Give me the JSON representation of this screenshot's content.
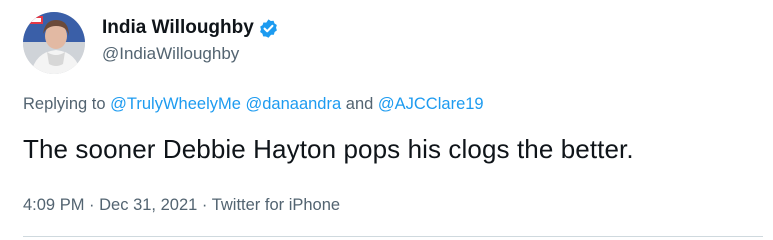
{
  "author": {
    "display_name": "India Willoughby",
    "handle": "@IndiaWilloughby",
    "verified": true,
    "avatar_icon": "profile-photo"
  },
  "reply": {
    "prefix": "Replying to",
    "mention_1": "@TrulyWheelyMe",
    "mention_2": "@danaandra",
    "conjunction": "and",
    "mention_3": "@AJCClare19"
  },
  "tweet": {
    "text": "The sooner Debbie Hayton pops his clogs the better."
  },
  "meta": {
    "time": "4:09 PM",
    "separator_1": "·",
    "date": "Dec 31, 2021",
    "separator_2": "·",
    "source": "Twitter for iPhone"
  },
  "colors": {
    "accent": "#1d9bf0",
    "muted_text": "#536471",
    "main_text": "#0f1419",
    "divider": "#cfd9de"
  }
}
